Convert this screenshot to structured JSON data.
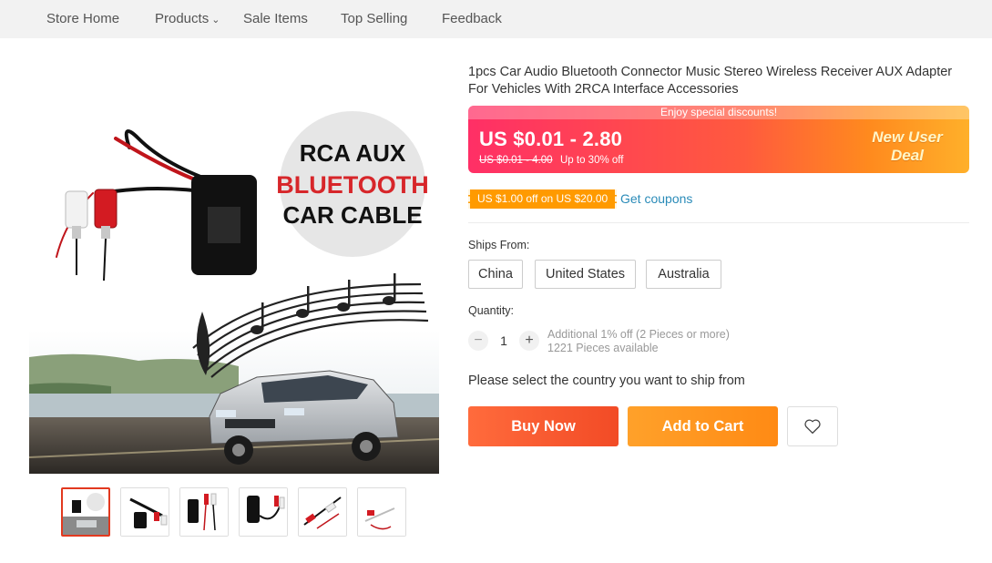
{
  "nav": {
    "items": [
      "Store Home",
      "Products",
      "Sale Items",
      "Top Selling",
      "Feedback"
    ]
  },
  "gallery": {
    "banner_line1": "RCA AUX",
    "banner_line2": "BLUETOOTH",
    "banner_line3": "CAR CABLE",
    "thumbnail_count": 6,
    "active_thumbnail": 1
  },
  "product": {
    "title": "1pcs Car Audio Bluetooth Connector Music Stereo Wireless Receiver AUX Adapter For Vehicles With 2RCA Interface Accessories"
  },
  "pricing": {
    "banner_text": "Enjoy special discounts!",
    "price": "US $0.01 - 2.80",
    "original_price": "US $0.01 - 4.00",
    "discount": "Up to 30% off",
    "deal_line1": "New User",
    "deal_line2": "Deal"
  },
  "coupon": {
    "tag": "US $1.00 off on US $20.00",
    "link": "Get coupons"
  },
  "shipping": {
    "label": "Ships From:",
    "options": [
      "China",
      "United States",
      "Australia"
    ]
  },
  "quantity": {
    "label": "Quantity:",
    "value": "1",
    "note_discount": "Additional 1% off (2 Pieces or more)",
    "note_available": "1221 Pieces available"
  },
  "ship_message": "Please select the country you want to ship from",
  "actions": {
    "buy_now": "Buy Now",
    "add_to_cart": "Add to Cart"
  },
  "colors": {
    "buy_now": "#f24b26",
    "add_to_cart": "#ff8a14",
    "coupon": "#ff9a00",
    "link": "#2a8bb8"
  }
}
